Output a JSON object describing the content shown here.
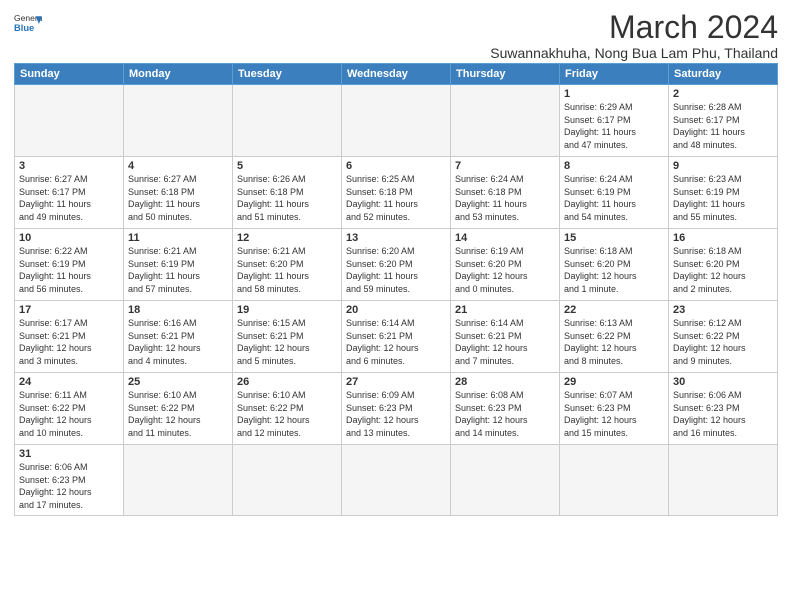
{
  "header": {
    "logo_general": "General",
    "logo_blue": "Blue",
    "month_year": "March 2024",
    "location": "Suwannakhuha, Nong Bua Lam Phu, Thailand"
  },
  "weekdays": [
    "Sunday",
    "Monday",
    "Tuesday",
    "Wednesday",
    "Thursday",
    "Friday",
    "Saturday"
  ],
  "weeks": [
    [
      {
        "day": "",
        "info": ""
      },
      {
        "day": "",
        "info": ""
      },
      {
        "day": "",
        "info": ""
      },
      {
        "day": "",
        "info": ""
      },
      {
        "day": "",
        "info": ""
      },
      {
        "day": "1",
        "info": "Sunrise: 6:29 AM\nSunset: 6:17 PM\nDaylight: 11 hours\nand 47 minutes."
      },
      {
        "day": "2",
        "info": "Sunrise: 6:28 AM\nSunset: 6:17 PM\nDaylight: 11 hours\nand 48 minutes."
      }
    ],
    [
      {
        "day": "3",
        "info": "Sunrise: 6:27 AM\nSunset: 6:17 PM\nDaylight: 11 hours\nand 49 minutes."
      },
      {
        "day": "4",
        "info": "Sunrise: 6:27 AM\nSunset: 6:18 PM\nDaylight: 11 hours\nand 50 minutes."
      },
      {
        "day": "5",
        "info": "Sunrise: 6:26 AM\nSunset: 6:18 PM\nDaylight: 11 hours\nand 51 minutes."
      },
      {
        "day": "6",
        "info": "Sunrise: 6:25 AM\nSunset: 6:18 PM\nDaylight: 11 hours\nand 52 minutes."
      },
      {
        "day": "7",
        "info": "Sunrise: 6:24 AM\nSunset: 6:18 PM\nDaylight: 11 hours\nand 53 minutes."
      },
      {
        "day": "8",
        "info": "Sunrise: 6:24 AM\nSunset: 6:19 PM\nDaylight: 11 hours\nand 54 minutes."
      },
      {
        "day": "9",
        "info": "Sunrise: 6:23 AM\nSunset: 6:19 PM\nDaylight: 11 hours\nand 55 minutes."
      }
    ],
    [
      {
        "day": "10",
        "info": "Sunrise: 6:22 AM\nSunset: 6:19 PM\nDaylight: 11 hours\nand 56 minutes."
      },
      {
        "day": "11",
        "info": "Sunrise: 6:21 AM\nSunset: 6:19 PM\nDaylight: 11 hours\nand 57 minutes."
      },
      {
        "day": "12",
        "info": "Sunrise: 6:21 AM\nSunset: 6:20 PM\nDaylight: 11 hours\nand 58 minutes."
      },
      {
        "day": "13",
        "info": "Sunrise: 6:20 AM\nSunset: 6:20 PM\nDaylight: 11 hours\nand 59 minutes."
      },
      {
        "day": "14",
        "info": "Sunrise: 6:19 AM\nSunset: 6:20 PM\nDaylight: 12 hours\nand 0 minutes."
      },
      {
        "day": "15",
        "info": "Sunrise: 6:18 AM\nSunset: 6:20 PM\nDaylight: 12 hours\nand 1 minute."
      },
      {
        "day": "16",
        "info": "Sunrise: 6:18 AM\nSunset: 6:20 PM\nDaylight: 12 hours\nand 2 minutes."
      }
    ],
    [
      {
        "day": "17",
        "info": "Sunrise: 6:17 AM\nSunset: 6:21 PM\nDaylight: 12 hours\nand 3 minutes."
      },
      {
        "day": "18",
        "info": "Sunrise: 6:16 AM\nSunset: 6:21 PM\nDaylight: 12 hours\nand 4 minutes."
      },
      {
        "day": "19",
        "info": "Sunrise: 6:15 AM\nSunset: 6:21 PM\nDaylight: 12 hours\nand 5 minutes."
      },
      {
        "day": "20",
        "info": "Sunrise: 6:14 AM\nSunset: 6:21 PM\nDaylight: 12 hours\nand 6 minutes."
      },
      {
        "day": "21",
        "info": "Sunrise: 6:14 AM\nSunset: 6:21 PM\nDaylight: 12 hours\nand 7 minutes."
      },
      {
        "day": "22",
        "info": "Sunrise: 6:13 AM\nSunset: 6:22 PM\nDaylight: 12 hours\nand 8 minutes."
      },
      {
        "day": "23",
        "info": "Sunrise: 6:12 AM\nSunset: 6:22 PM\nDaylight: 12 hours\nand 9 minutes."
      }
    ],
    [
      {
        "day": "24",
        "info": "Sunrise: 6:11 AM\nSunset: 6:22 PM\nDaylight: 12 hours\nand 10 minutes."
      },
      {
        "day": "25",
        "info": "Sunrise: 6:10 AM\nSunset: 6:22 PM\nDaylight: 12 hours\nand 11 minutes."
      },
      {
        "day": "26",
        "info": "Sunrise: 6:10 AM\nSunset: 6:22 PM\nDaylight: 12 hours\nand 12 minutes."
      },
      {
        "day": "27",
        "info": "Sunrise: 6:09 AM\nSunset: 6:23 PM\nDaylight: 12 hours\nand 13 minutes."
      },
      {
        "day": "28",
        "info": "Sunrise: 6:08 AM\nSunset: 6:23 PM\nDaylight: 12 hours\nand 14 minutes."
      },
      {
        "day": "29",
        "info": "Sunrise: 6:07 AM\nSunset: 6:23 PM\nDaylight: 12 hours\nand 15 minutes."
      },
      {
        "day": "30",
        "info": "Sunrise: 6:06 AM\nSunset: 6:23 PM\nDaylight: 12 hours\nand 16 minutes."
      }
    ],
    [
      {
        "day": "31",
        "info": "Sunrise: 6:06 AM\nSunset: 6:23 PM\nDaylight: 12 hours\nand 17 minutes."
      },
      {
        "day": "",
        "info": ""
      },
      {
        "day": "",
        "info": ""
      },
      {
        "day": "",
        "info": ""
      },
      {
        "day": "",
        "info": ""
      },
      {
        "day": "",
        "info": ""
      },
      {
        "day": "",
        "info": ""
      }
    ]
  ]
}
